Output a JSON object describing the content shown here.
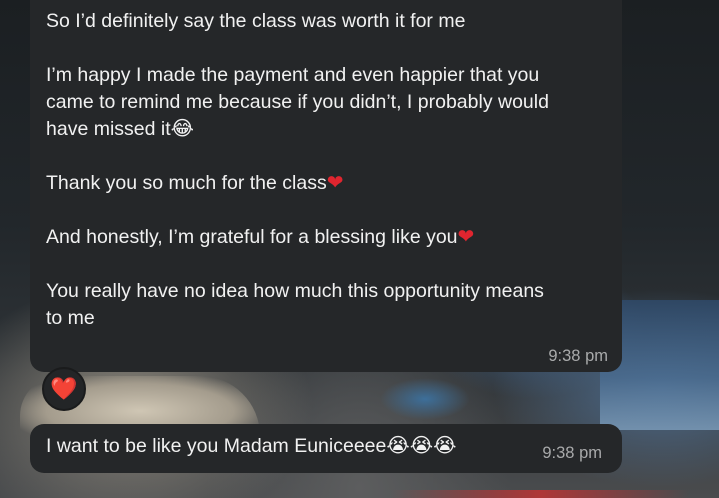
{
  "messages": [
    {
      "lines": [
        "So I’d definitely say the class was worth it for me",
        "",
        "I’m happy I made the payment and even happier that you",
        "came to remind me because if you didn’t, I probably would",
        "have missed it",
        "",
        "Thank you so much for the class",
        "",
        "And honestly, I’m grateful for a blessing like you",
        "",
        "You really have no idea how much this opportunity means",
        "to me"
      ],
      "time": "9:38 pm",
      "reaction": "❤️"
    },
    {
      "text": "I want to be like you Madam Euniceeee",
      "emoji": "😭😭😭",
      "time": "9:38 pm"
    }
  ],
  "emojis": {
    "laughing": "😂",
    "heart": "❤"
  }
}
